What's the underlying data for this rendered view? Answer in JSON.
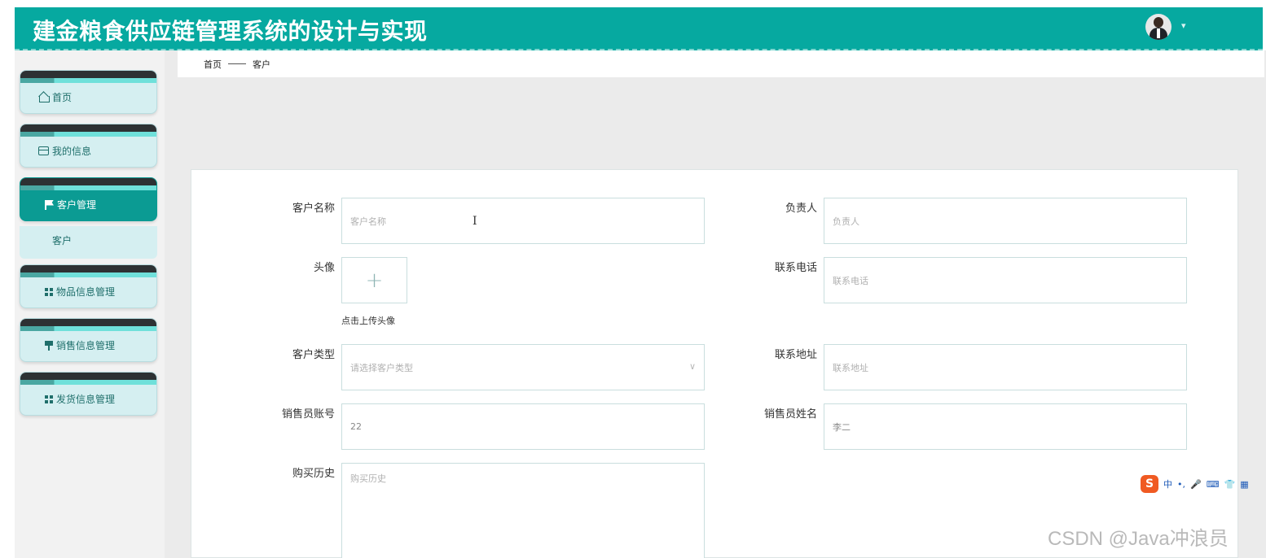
{
  "app": {
    "title": "建金粮食供应链管理系统的设计与实现",
    "caret": "▾"
  },
  "sidebar": {
    "items": [
      {
        "label": "首页",
        "icon": "home-icon"
      },
      {
        "label": "我的信息",
        "icon": "card-icon"
      },
      {
        "label": "客户管理",
        "icon": "flag-icon",
        "active": true
      },
      {
        "label": "物品信息管理",
        "icon": "grid-icon"
      },
      {
        "label": "销售信息管理",
        "icon": "post-icon"
      },
      {
        "label": "发货信息管理",
        "icon": "grid-icon"
      }
    ],
    "submenu": {
      "label": "客户"
    }
  },
  "breadcrumb": {
    "home": "首页",
    "current": "客户"
  },
  "form": {
    "customer_name": {
      "label": "客户名称",
      "placeholder": "客户名称"
    },
    "manager": {
      "label": "负责人",
      "placeholder": "负责人"
    },
    "avatar": {
      "label": "头像",
      "plus": "+",
      "hint": "点击上传头像"
    },
    "phone": {
      "label": "联系电话",
      "placeholder": "联系电话"
    },
    "customer_type": {
      "label": "客户类型",
      "placeholder": "请选择客户类型",
      "arrow": "∨"
    },
    "address": {
      "label": "联系地址",
      "placeholder": "联系地址"
    },
    "sales_account": {
      "label": "销售员账号",
      "value": "22"
    },
    "sales_name": {
      "label": "销售员姓名",
      "value": "李二"
    },
    "purchase_history": {
      "label": "购买历史",
      "placeholder": "购买历史"
    }
  },
  "ime": {
    "logo": "S",
    "lang": "中",
    "punct": "•,"
  },
  "watermark": "CSDN @Java冲浪员",
  "colors": {
    "header": "#06a9a0",
    "accent": "#0b9b93",
    "sidebar_card": "#d5eff1"
  }
}
